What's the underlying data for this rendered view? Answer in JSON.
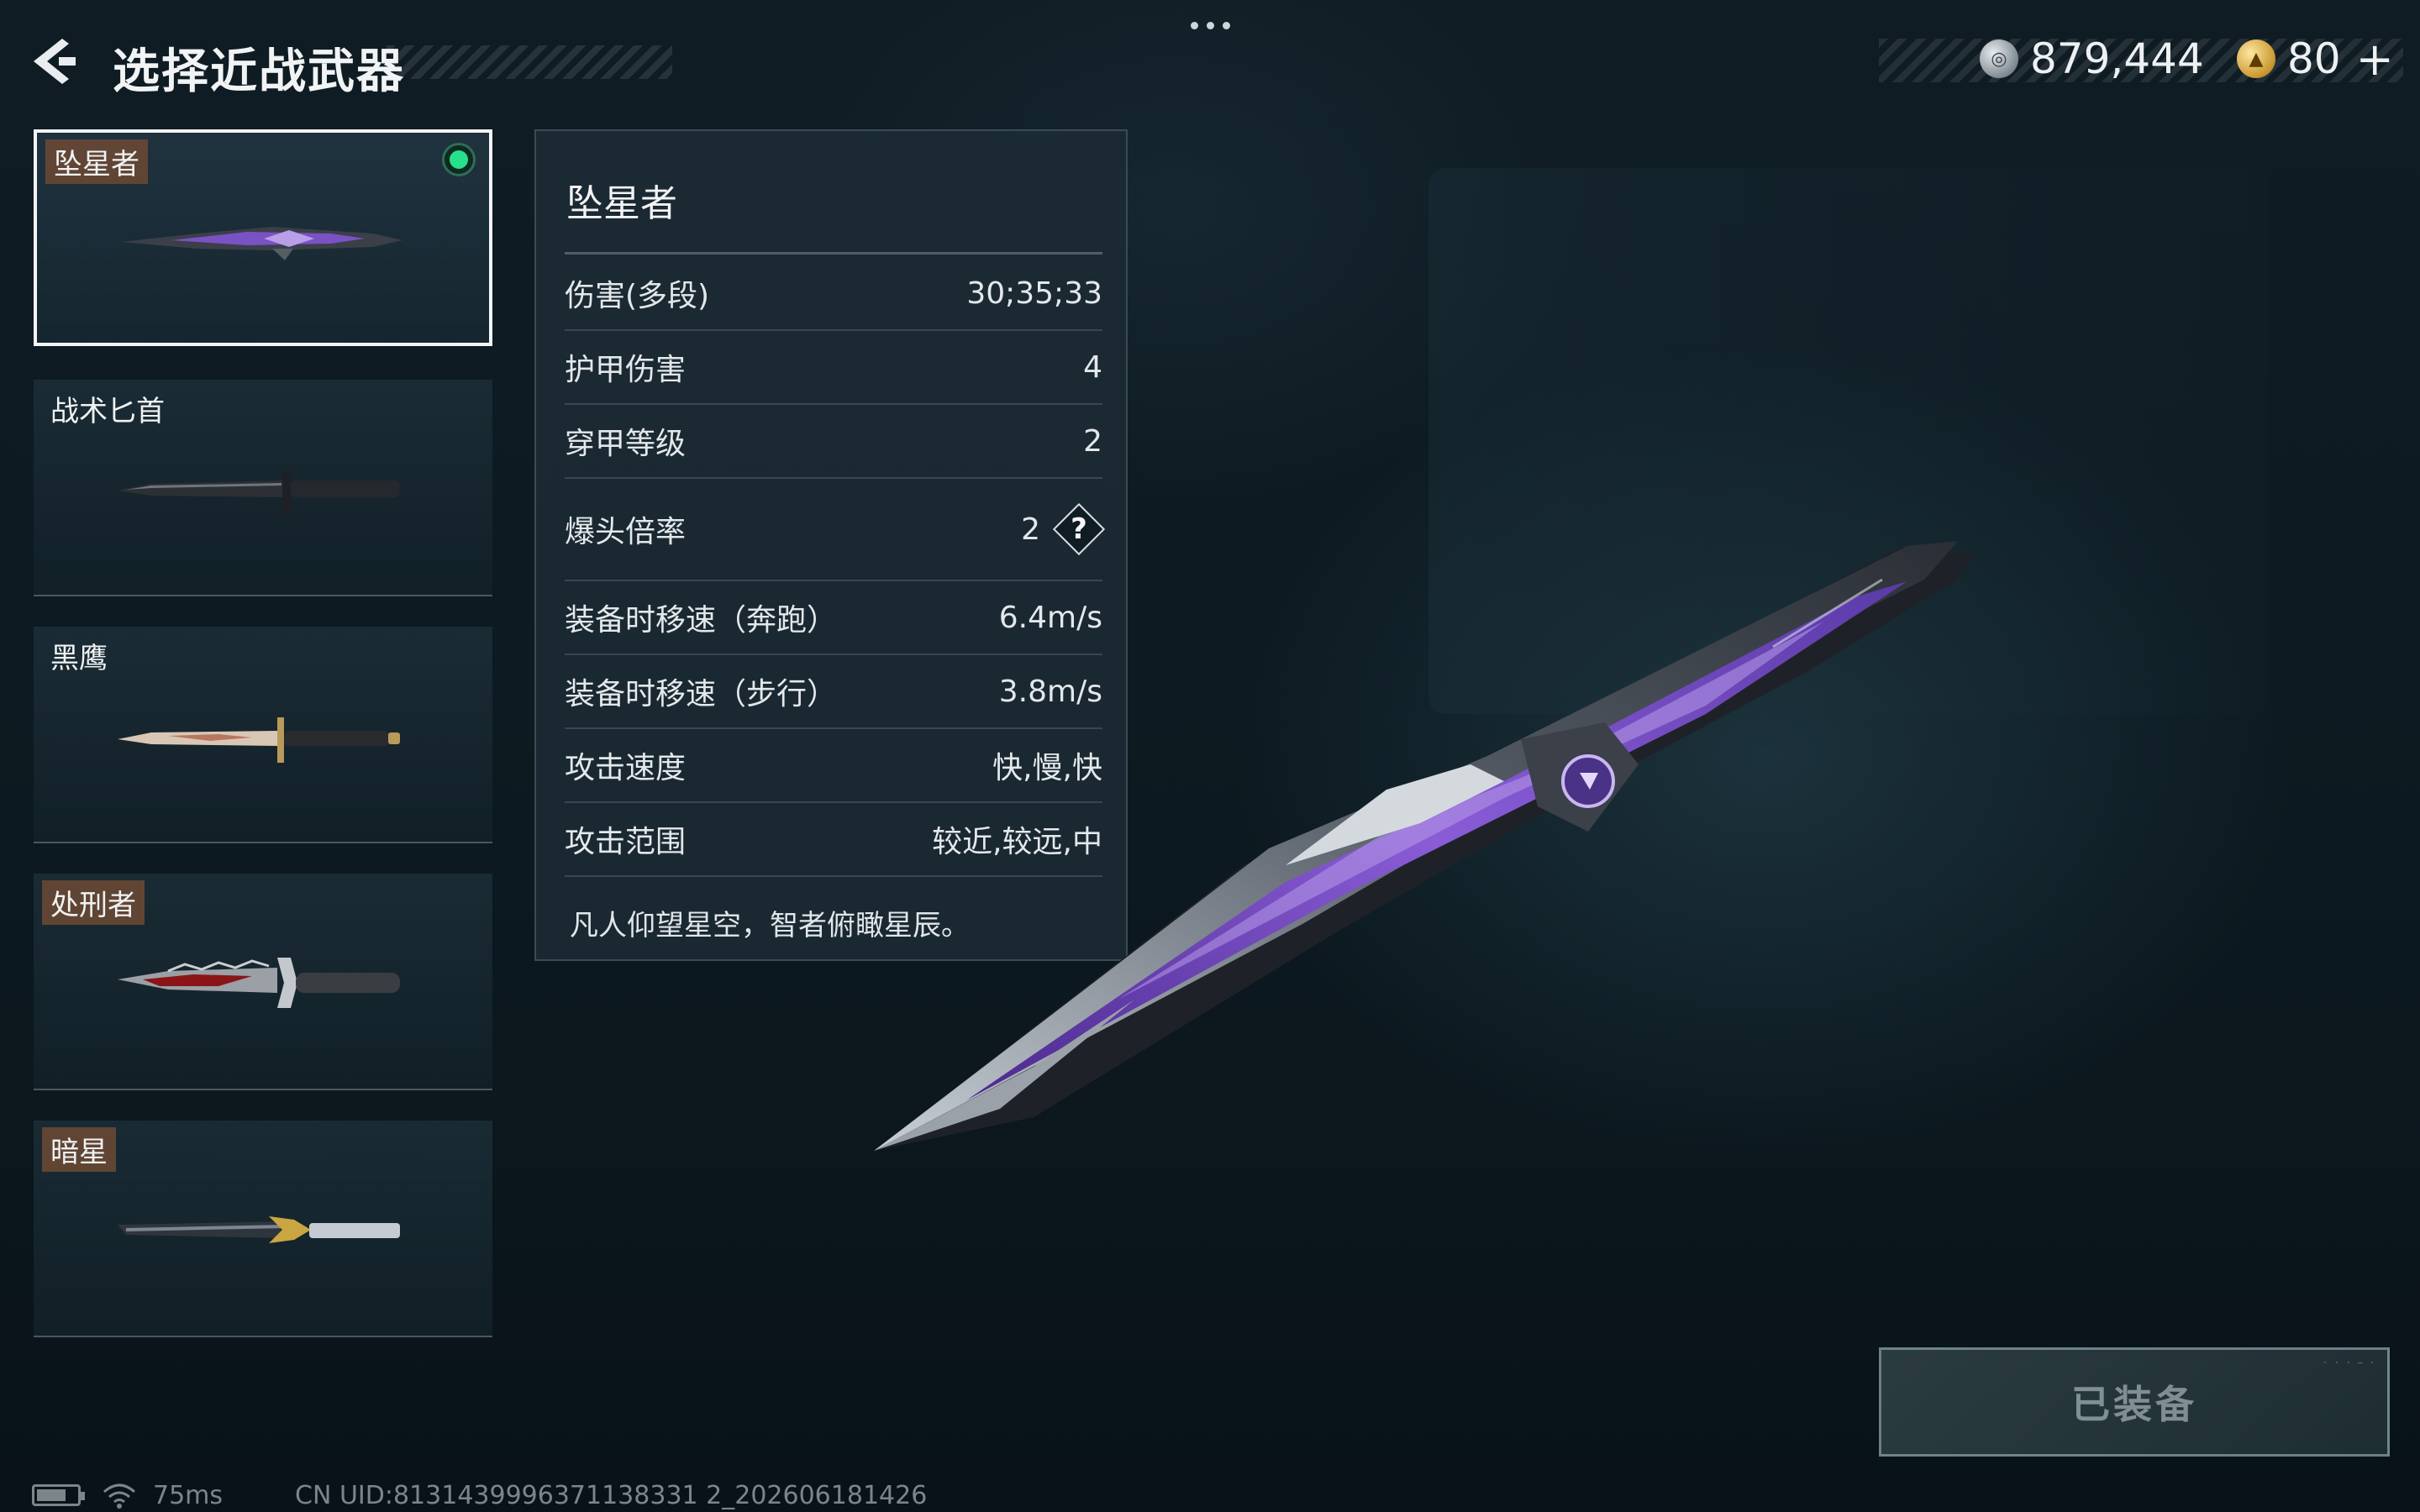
{
  "header": {
    "title": "选择近战武器",
    "back_icon": "chevron-left-icon",
    "more_icon": "ellipsis-icon"
  },
  "currency": {
    "silver": {
      "amount": "879,444",
      "icon": "silver-coin-icon"
    },
    "gold": {
      "amount": "80",
      "icon": "gold-triangle-coin-icon"
    },
    "plus_label": "+"
  },
  "weapons": [
    {
      "name": "坠星者",
      "selected": true,
      "equipped": true,
      "tagged": true
    },
    {
      "name": "战术匕首",
      "selected": false,
      "equipped": false,
      "tagged": false
    },
    {
      "name": "黑鹰",
      "selected": false,
      "equipped": false,
      "tagged": false
    },
    {
      "name": "处刑者",
      "selected": false,
      "equipped": false,
      "tagged": true
    },
    {
      "name": "暗星",
      "selected": false,
      "equipped": false,
      "tagged": true
    }
  ],
  "stats": {
    "title": "坠星者",
    "rows": [
      {
        "label": "伤害(多段)",
        "value": "30;35;33"
      },
      {
        "label": "护甲伤害",
        "value": "4"
      },
      {
        "label": "穿甲等级",
        "value": "2"
      },
      {
        "label": "爆头倍率",
        "value": "2",
        "help": "?"
      },
      {
        "label": "装备时移速（奔跑）",
        "value": "6.4m/s"
      },
      {
        "label": "装备时移速（步行）",
        "value": "3.8m/s"
      },
      {
        "label": "攻击速度",
        "value": "快,慢,快"
      },
      {
        "label": "攻击范围",
        "value": "较近,较远,中"
      }
    ],
    "description": "凡人仰望星空，智者俯瞰星辰。"
  },
  "equip_button": {
    "label": "已装备",
    "state": "disabled"
  },
  "status_bar": {
    "ping": "75ms",
    "uid": "CN UID:8131439996371138331 2_202606181426"
  },
  "colors": {
    "equipped_indicator": "#27e08a",
    "label_tag": "#684834",
    "accent_purple": "#8a5cd6"
  }
}
